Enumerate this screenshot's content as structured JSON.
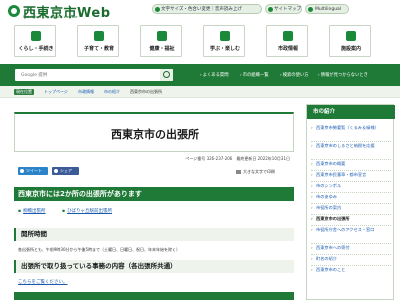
{
  "header": {
    "site_title": "西東京市Web",
    "site_subtitle": "Nishitokyo City Official Website",
    "buttons": [
      {
        "label": "文字サイズ・色合い変更｜音声読み上げ"
      },
      {
        "label": "サイトマップ"
      }
    ],
    "language_label": "Multilingual"
  },
  "nav": {
    "items": [
      {
        "label": "くらし・手続き"
      },
      {
        "label": "子育て・教育"
      },
      {
        "label": "健康・福祉"
      },
      {
        "label": "学ぶ・楽しむ"
      },
      {
        "label": "市政情報"
      },
      {
        "label": "施設案内"
      }
    ]
  },
  "search": {
    "placeholder": "Google 提供",
    "quick_links": [
      "よくある質問",
      "市の組織一覧",
      "検索の使い方",
      "情報が見つからないとき"
    ]
  },
  "breadcrumb": {
    "here_label": "現在位置",
    "items": [
      "トップページ",
      "市政情報",
      "市の紹介"
    ],
    "current": "西東京市の出張所"
  },
  "main": {
    "title": "西東京市の出張所",
    "meta": "ページ番号 326-237-206　最終更新日 2022年10月31日",
    "share": {
      "twitter": "ツイート",
      "facebook": "シェア"
    },
    "print_label": "大きな文字で印刷",
    "section_heading": "西東京市には2か所の出張所があります",
    "offices": [
      "柳橋出張所",
      "ひばりヶ丘駅前出張所"
    ],
    "hours_heading": "開所時間",
    "hours_text": "各出張所とも、午前9時30分から午後5時まで（土曜日、日曜日、祝日、年末年始を除く）",
    "services_heading": "出張所で取り扱っている事務の内容（各出張所共通）",
    "more_link": "こちらをご覧ください。"
  },
  "sidebar": {
    "heading": "市の紹介",
    "items": [
      {
        "label": "西東京市勢要覧（くるみ＆緑様）",
        "current": false
      },
      {
        "label": "西東京市のしるさと納税を応援",
        "current": false
      },
      {
        "label": "西東京市の概要",
        "current": false
      },
      {
        "label": "西東京市民憲章・都市宣言",
        "current": false
      },
      {
        "label": "市のシンボル",
        "current": false
      },
      {
        "label": "市のあゆみ",
        "current": false
      },
      {
        "label": "市役所の案内",
        "current": false
      },
      {
        "label": "西東京市の出張所",
        "current": true
      },
      {
        "label": "市役所庁舎へのアクセス・窓口",
        "current": false
      },
      {
        "label": "西東京市への寄付",
        "current": false
      },
      {
        "label": "町名の紹介",
        "current": false
      },
      {
        "label": "西東京市のこと",
        "current": false
      }
    ]
  },
  "colors": {
    "brand_green": "#1f7a37",
    "link_blue": "#1a5bb0",
    "twitter_blue": "#2b84c9",
    "facebook_blue": "#3b5a98"
  }
}
